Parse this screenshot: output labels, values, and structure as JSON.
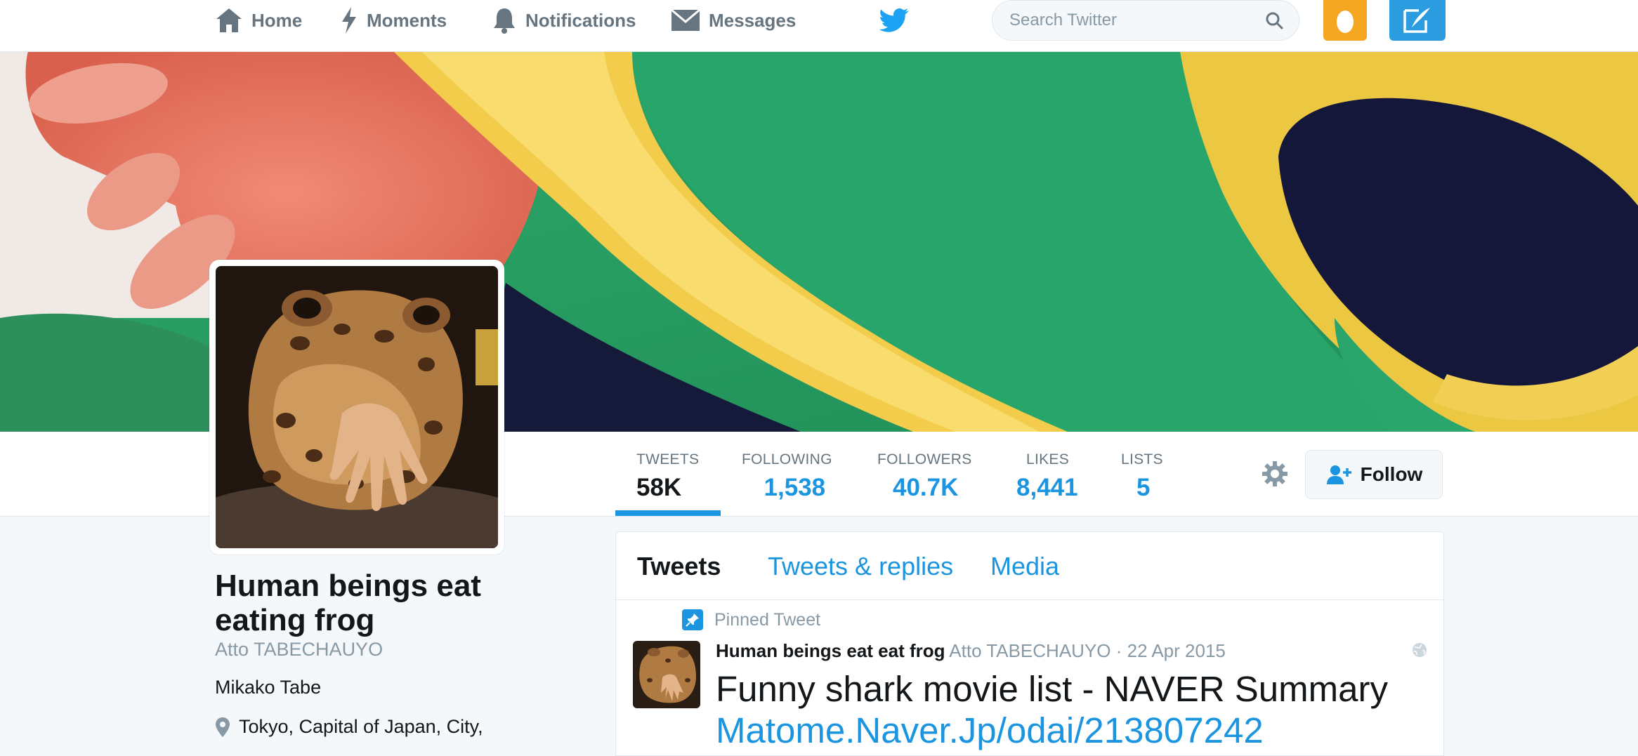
{
  "nav": {
    "home": "Home",
    "moments": "Moments",
    "notifications": "Notifications",
    "messages": "Messages",
    "search_placeholder": "Search Twitter"
  },
  "colors": {
    "accent": "#1b95e0",
    "avatar_button": "#f5a623",
    "tweet_button": "#2b9ce0"
  },
  "stats": [
    {
      "label": "TWEETS",
      "value": "58K",
      "active": true
    },
    {
      "label": "FOLLOWING",
      "value": "1,538"
    },
    {
      "label": "FOLLOWERS",
      "value": "40.7K"
    },
    {
      "label": "LIKES",
      "value": "8,441"
    },
    {
      "label": "LISTS",
      "value": "5"
    }
  ],
  "follow_label": "Follow",
  "profile": {
    "name": "Human beings eat eating frog",
    "handle": "Atto TABECHAUYO",
    "bio": "Mikako Tabe",
    "location": "Tokyo, Capital of Japan, City,"
  },
  "timeline": {
    "tabs": [
      "Tweets",
      "Tweets & replies",
      "Media"
    ],
    "pinned_label": "Pinned Tweet",
    "tweet": {
      "name": "Human beings eat eat frog",
      "handle": "Atto TABECHAUYO",
      "date": "· 22 Apr 2015",
      "text": "Funny shark movie list - NAVER Summary",
      "link": "Matome.Naver.Jp/odai/213807242"
    }
  },
  "icons": {
    "home": "home-icon",
    "moments": "lightning-icon",
    "notifications": "bell-icon",
    "messages": "envelope-icon",
    "logo": "twitter-bird-icon",
    "search": "search-icon",
    "settings": "gear-icon",
    "follow": "add-user-icon",
    "pin": "pin-icon",
    "location": "location-pin-icon",
    "globe": "globe-icon"
  }
}
